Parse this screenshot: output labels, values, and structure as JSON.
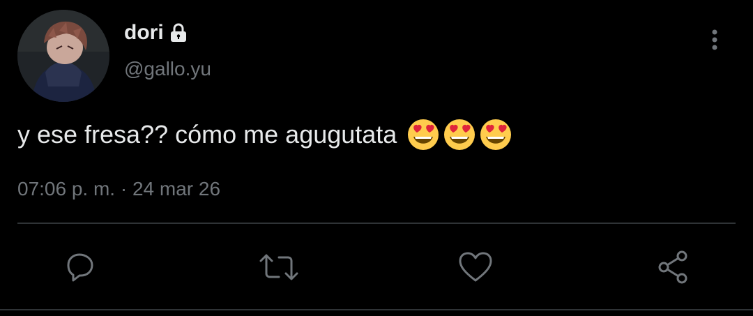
{
  "tweet": {
    "display_name": "dori",
    "handle": "@gallo.yu",
    "text": "y ese fresa?? cómo me agugutata",
    "emojis": [
      "heart-eyes-emoji",
      "heart-eyes-emoji",
      "heart-eyes-emoji"
    ],
    "time": "07:06 p. m.",
    "separator": "·",
    "date": "24 mar 26"
  },
  "icons": {
    "lock": "lock-icon",
    "more": "more-vertical-icon",
    "reply": "reply-icon",
    "retweet": "retweet-icon",
    "like": "heart-icon",
    "share": "share-icon"
  },
  "colors": {
    "background": "#000000",
    "primary_text": "#e7e9ea",
    "secondary_text": "#71767b",
    "divider": "#2f3336"
  }
}
